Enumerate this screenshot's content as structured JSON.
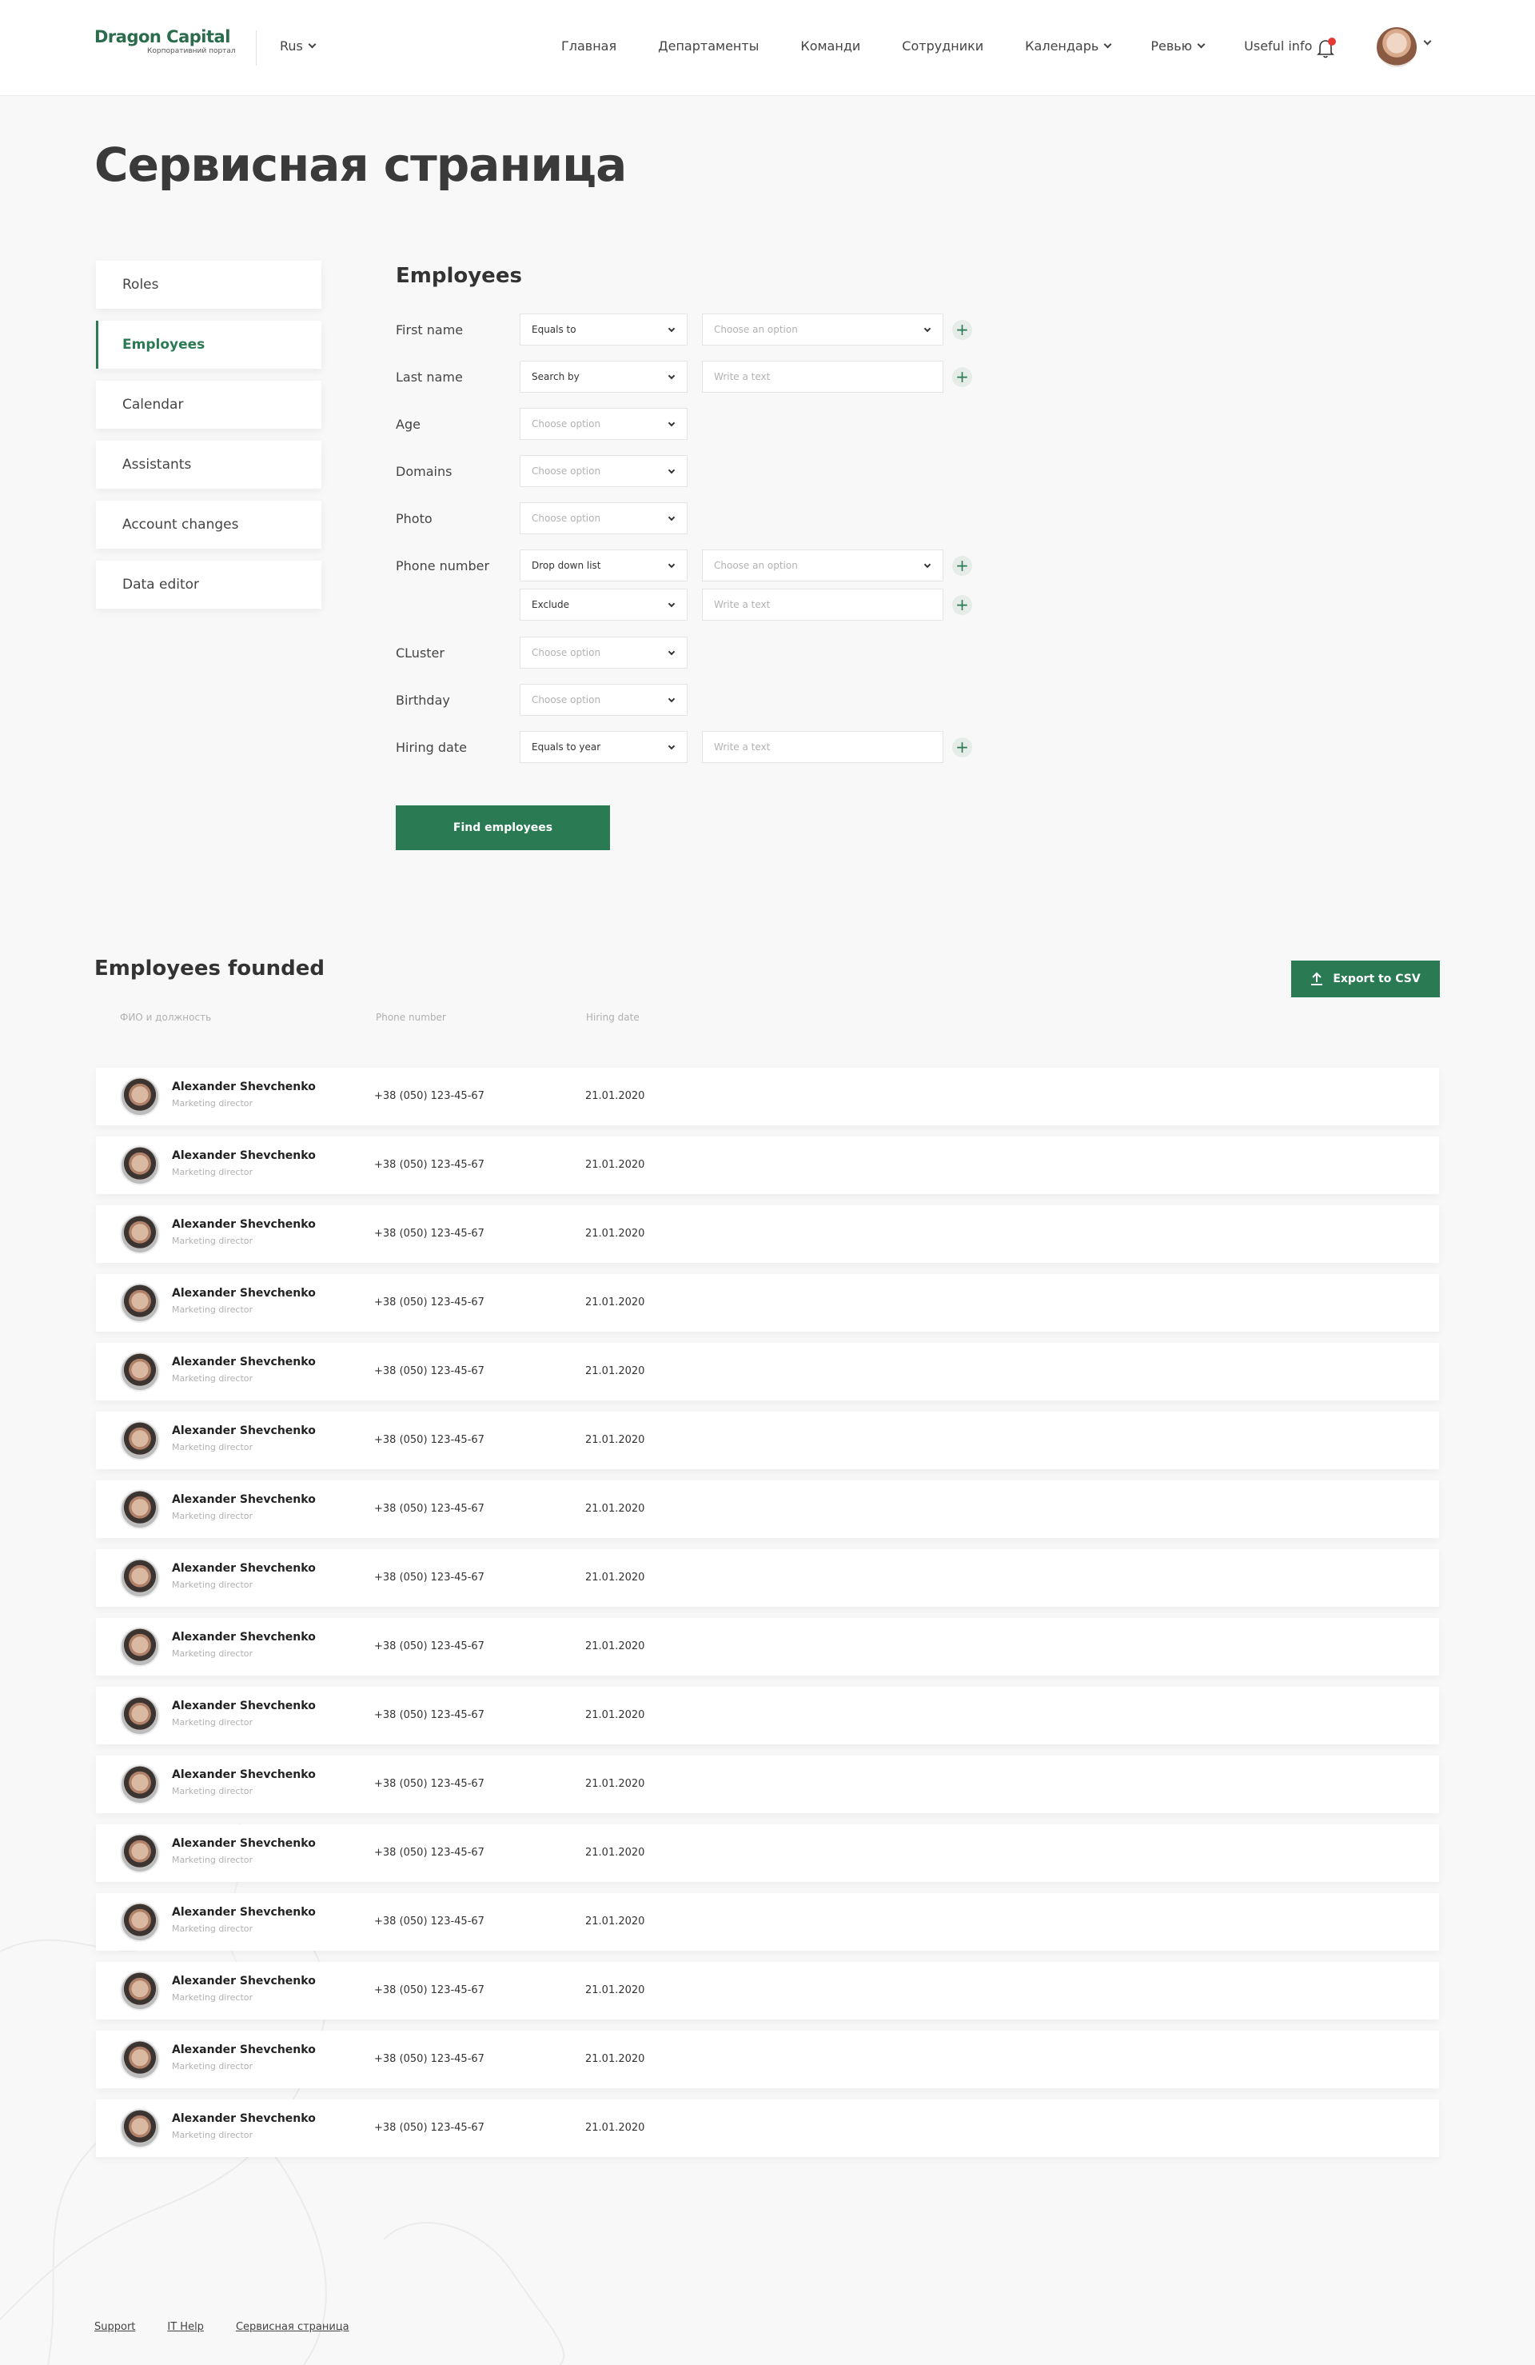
{
  "header": {
    "logo_text": "Dragon Capital",
    "logo_subtitle": "Корпоративний портал",
    "language": "Rus",
    "nav": [
      {
        "label": "Главная",
        "dropdown": false
      },
      {
        "label": "Департаменты",
        "dropdown": false
      },
      {
        "label": "Команди",
        "dropdown": false
      },
      {
        "label": "Сотрудники",
        "dropdown": false
      },
      {
        "label": "Календарь",
        "dropdown": true
      },
      {
        "label": "Ревью",
        "dropdown": true
      },
      {
        "label": "Useful info",
        "dropdown": false
      }
    ],
    "notification_icon": "bell-icon",
    "has_notification": true
  },
  "page": {
    "title": "Сервисная страница"
  },
  "sidebar": {
    "items": [
      {
        "label": "Roles",
        "active": false
      },
      {
        "label": "Employees",
        "active": true
      },
      {
        "label": "Calendar",
        "active": false
      },
      {
        "label": "Assistants",
        "active": false
      },
      {
        "label": "Account changes",
        "active": false
      },
      {
        "label": "Data editor",
        "active": false
      }
    ]
  },
  "filters": {
    "title": "Employees",
    "rows": [
      {
        "label": "First name",
        "select": "Equals to",
        "second": {
          "type": "select",
          "placeholder": "Choose an option"
        }
      },
      {
        "label": "Last name",
        "select": "Search by",
        "second": {
          "type": "text",
          "placeholder": "Write a text"
        }
      },
      {
        "label": "Age",
        "select_placeholder": "Choose option"
      },
      {
        "label": "Domains",
        "select_placeholder": "Choose option"
      },
      {
        "label": "Photo",
        "select_placeholder": "Choose option"
      },
      {
        "label": "Phone number",
        "select": "Drop down list",
        "second": {
          "type": "select",
          "placeholder": "Choose an option"
        }
      },
      {
        "label": "",
        "select": "Exclude",
        "second": {
          "type": "text",
          "placeholder": "Write a text"
        }
      },
      {
        "label": "CLuster",
        "select_placeholder": "Choose option"
      },
      {
        "label": "Birthday",
        "select_placeholder": "Choose option"
      },
      {
        "label": "Hiring date",
        "select": "Equals to year",
        "second": {
          "type": "text",
          "placeholder": "Write a text"
        }
      }
    ],
    "submit_label": "Find employees"
  },
  "results": {
    "title": "Employees founded",
    "export_label": "Export to CSV",
    "columns": [
      "ФИО и должность",
      "Phone number",
      "Hiring date"
    ],
    "rows": [
      {
        "name": "Alexander Shevchenko",
        "position": "Marketing director",
        "phone": "+38 (050) 123-45-67",
        "hiring_date": "21.01.2020"
      },
      {
        "name": "Alexander Shevchenko",
        "position": "Marketing director",
        "phone": "+38 (050) 123-45-67",
        "hiring_date": "21.01.2020"
      },
      {
        "name": "Alexander Shevchenko",
        "position": "Marketing director",
        "phone": "+38 (050) 123-45-67",
        "hiring_date": "21.01.2020"
      },
      {
        "name": "Alexander Shevchenko",
        "position": "Marketing director",
        "phone": "+38 (050) 123-45-67",
        "hiring_date": "21.01.2020"
      },
      {
        "name": "Alexander Shevchenko",
        "position": "Marketing director",
        "phone": "+38 (050) 123-45-67",
        "hiring_date": "21.01.2020"
      },
      {
        "name": "Alexander Shevchenko",
        "position": "Marketing director",
        "phone": "+38 (050) 123-45-67",
        "hiring_date": "21.01.2020"
      },
      {
        "name": "Alexander Shevchenko",
        "position": "Marketing director",
        "phone": "+38 (050) 123-45-67",
        "hiring_date": "21.01.2020"
      },
      {
        "name": "Alexander Shevchenko",
        "position": "Marketing director",
        "phone": "+38 (050) 123-45-67",
        "hiring_date": "21.01.2020"
      },
      {
        "name": "Alexander Shevchenko",
        "position": "Marketing director",
        "phone": "+38 (050) 123-45-67",
        "hiring_date": "21.01.2020"
      },
      {
        "name": "Alexander Shevchenko",
        "position": "Marketing director",
        "phone": "+38 (050) 123-45-67",
        "hiring_date": "21.01.2020"
      },
      {
        "name": "Alexander Shevchenko",
        "position": "Marketing director",
        "phone": "+38 (050) 123-45-67",
        "hiring_date": "21.01.2020"
      },
      {
        "name": "Alexander Shevchenko",
        "position": "Marketing director",
        "phone": "+38 (050) 123-45-67",
        "hiring_date": "21.01.2020"
      },
      {
        "name": "Alexander Shevchenko",
        "position": "Marketing director",
        "phone": "+38 (050) 123-45-67",
        "hiring_date": "21.01.2020"
      },
      {
        "name": "Alexander Shevchenko",
        "position": "Marketing director",
        "phone": "+38 (050) 123-45-67",
        "hiring_date": "21.01.2020"
      },
      {
        "name": "Alexander Shevchenko",
        "position": "Marketing director",
        "phone": "+38 (050) 123-45-67",
        "hiring_date": "21.01.2020"
      },
      {
        "name": "Alexander Shevchenko",
        "position": "Marketing director",
        "phone": "+38 (050) 123-45-67",
        "hiring_date": "21.01.2020"
      }
    ]
  },
  "footer": {
    "links": [
      "Support",
      "IT Help",
      "Сервисная страница"
    ]
  },
  "colors": {
    "accent": "#2a7a53",
    "background": "#f8f8f8",
    "notification_dot": "#e53935"
  }
}
